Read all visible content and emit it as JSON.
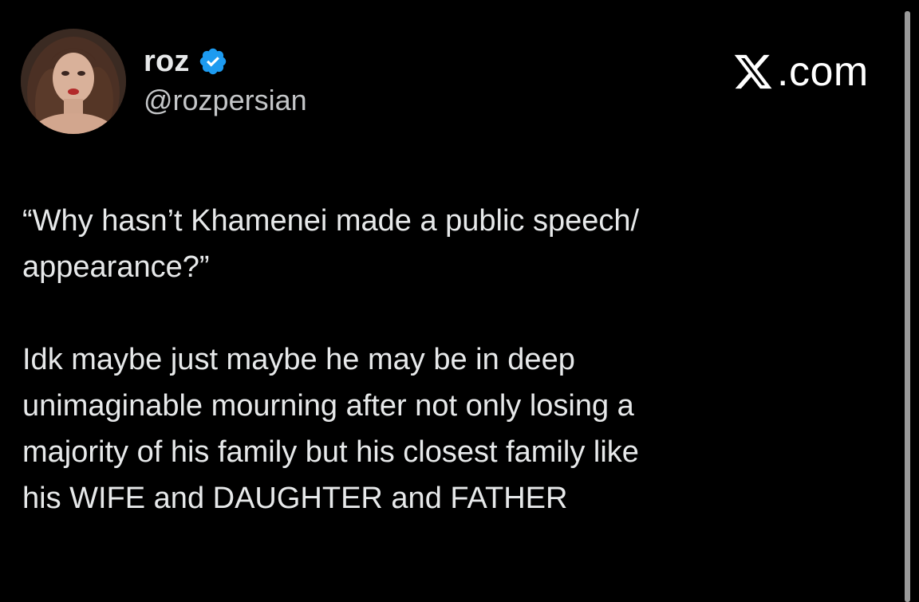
{
  "tweet": {
    "display_name": "roz",
    "handle": "@rozpersian",
    "verified": true,
    "brand": {
      "icon": "x-logo-icon",
      "text": ".com"
    },
    "paragraphs": [
      "“Why hasn’t Khamenei made a public speech/\nappearance?”",
      "Idk maybe just maybe he may be in deep\nunimaginable mourning after not only losing a\nmajority of his family but his closest family like\nhis WIFE and DAUGHTER and FATHER"
    ]
  },
  "colors": {
    "background": "#000000",
    "text": "#e7e9ea",
    "verified_badge": "#1d9bf0",
    "scrollbar": "#9a9a9a"
  }
}
